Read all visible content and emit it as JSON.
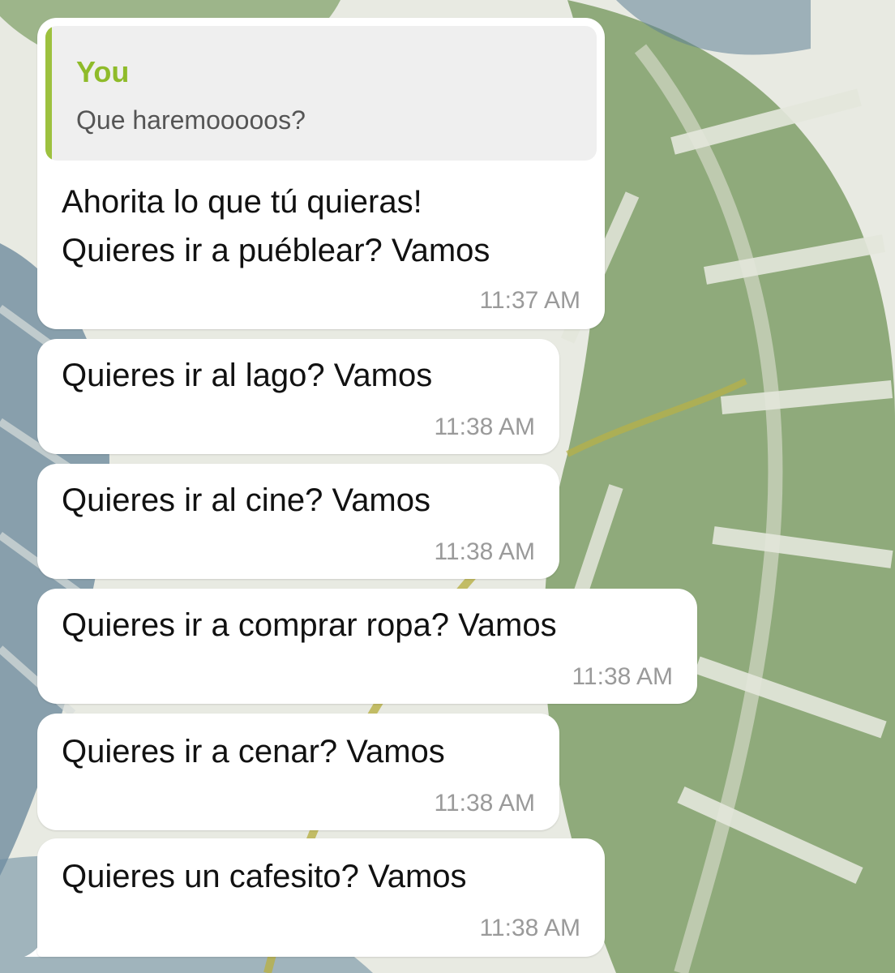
{
  "chat": {
    "reply_preview": {
      "author": "You",
      "text": "Que haremoooоos?"
    },
    "messages": [
      {
        "lines": [
          "Ahorita lo que tú quieras!",
          "Quieres ir a puéblear? Vamos"
        ],
        "time": "11:37 AM"
      },
      {
        "lines": [
          "Quieres ir al lago? Vamos"
        ],
        "time": "11:38 AM"
      },
      {
        "lines": [
          "Quieres ir al cine? Vamos"
        ],
        "time": "11:38 AM"
      },
      {
        "lines": [
          "Quieres ir a comprar ropa? Vamos"
        ],
        "time": "11:38 AM"
      },
      {
        "lines": [
          "Quieres ir a cenar? Vamos"
        ],
        "time": "11:38 AM"
      },
      {
        "lines": [
          "Quieres un cafesito? Vamos"
        ],
        "time": "11:38 AM"
      }
    ]
  },
  "colors": {
    "bubble": "#ffffff",
    "reply_accent": "#9dc13f",
    "reply_author": "#8fbb2a",
    "timestamp": "#9a9a9a",
    "wallpaper_leaf_green": "#7f9f68",
    "wallpaper_leaf_blue": "#5f7f96"
  },
  "icons": {
    "wallpaper": "tropical-monstera-leaves-wallpaper",
    "bubble_tail": "message-tail-icon"
  }
}
